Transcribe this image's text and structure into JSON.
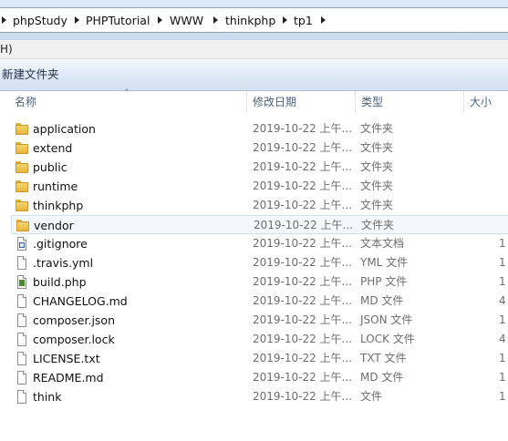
{
  "address_bar": {
    "crumbs": [
      "phpStudy",
      "PHPTutorial",
      "WWW",
      "thinkphp",
      "tp1"
    ]
  },
  "menubar": {
    "help_fragment": "H)"
  },
  "toolbar": {
    "new_folder": "新建文件夹"
  },
  "columns": {
    "name": "名称",
    "date": "修改日期",
    "type": "类型",
    "size": "大小"
  },
  "files": [
    {
      "name": "application",
      "date": "2019-10-22 上午...",
      "type": "文件夹",
      "size": "",
      "icon": "folder-icon"
    },
    {
      "name": "extend",
      "date": "2019-10-22 上午...",
      "type": "文件夹",
      "size": "",
      "icon": "folder-icon"
    },
    {
      "name": "public",
      "date": "2019-10-22 上午...",
      "type": "文件夹",
      "size": "",
      "icon": "folder-icon"
    },
    {
      "name": "runtime",
      "date": "2019-10-22 上午...",
      "type": "文件夹",
      "size": "",
      "icon": "folder-icon"
    },
    {
      "name": "thinkphp",
      "date": "2019-10-22 上午...",
      "type": "文件夹",
      "size": "",
      "icon": "folder-icon"
    },
    {
      "name": "vendor",
      "date": "2019-10-22 上午...",
      "type": "文件夹",
      "size": "",
      "icon": "folder-icon",
      "selected": true
    },
    {
      "name": ".gitignore",
      "date": "2019-10-22 上午...",
      "type": "文本文档",
      "size": "1",
      "icon": "text-document-icon"
    },
    {
      "name": ".travis.yml",
      "date": "2019-10-22 上午...",
      "type": "YML 文件",
      "size": "1",
      "icon": "file-icon"
    },
    {
      "name": "build.php",
      "date": "2019-10-22 上午...",
      "type": "PHP 文件",
      "size": "1",
      "icon": "php-file-icon"
    },
    {
      "name": "CHANGELOG.md",
      "date": "2019-10-22 上午...",
      "type": "MD 文件",
      "size": "4",
      "icon": "file-icon"
    },
    {
      "name": "composer.json",
      "date": "2019-10-22 上午...",
      "type": "JSON 文件",
      "size": "1",
      "icon": "file-icon"
    },
    {
      "name": "composer.lock",
      "date": "2019-10-22 上午...",
      "type": "LOCK 文件",
      "size": "4",
      "icon": "file-icon"
    },
    {
      "name": "LICENSE.txt",
      "date": "2019-10-22 上午...",
      "type": "TXT 文件",
      "size": "1",
      "icon": "file-icon"
    },
    {
      "name": "README.md",
      "date": "2019-10-22 上午...",
      "type": "MD 文件",
      "size": "1",
      "icon": "file-icon"
    },
    {
      "name": "think",
      "date": "2019-10-22 上午...",
      "type": "文件",
      "size": "1",
      "icon": "file-icon"
    }
  ]
}
